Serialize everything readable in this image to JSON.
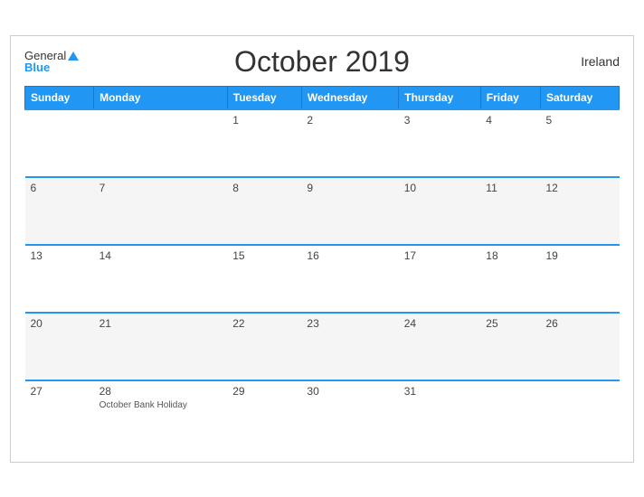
{
  "header": {
    "logo_general": "General",
    "logo_blue": "Blue",
    "title": "October 2019",
    "country": "Ireland"
  },
  "weekdays": [
    "Sunday",
    "Monday",
    "Tuesday",
    "Wednesday",
    "Thursday",
    "Friday",
    "Saturday"
  ],
  "weeks": [
    [
      {
        "day": "",
        "holiday": ""
      },
      {
        "day": "",
        "holiday": ""
      },
      {
        "day": "1",
        "holiday": ""
      },
      {
        "day": "2",
        "holiday": ""
      },
      {
        "day": "3",
        "holiday": ""
      },
      {
        "day": "4",
        "holiday": ""
      },
      {
        "day": "5",
        "holiday": ""
      }
    ],
    [
      {
        "day": "6",
        "holiday": ""
      },
      {
        "day": "7",
        "holiday": ""
      },
      {
        "day": "8",
        "holiday": ""
      },
      {
        "day": "9",
        "holiday": ""
      },
      {
        "day": "10",
        "holiday": ""
      },
      {
        "day": "11",
        "holiday": ""
      },
      {
        "day": "12",
        "holiday": ""
      }
    ],
    [
      {
        "day": "13",
        "holiday": ""
      },
      {
        "day": "14",
        "holiday": ""
      },
      {
        "day": "15",
        "holiday": ""
      },
      {
        "day": "16",
        "holiday": ""
      },
      {
        "day": "17",
        "holiday": ""
      },
      {
        "day": "18",
        "holiday": ""
      },
      {
        "day": "19",
        "holiday": ""
      }
    ],
    [
      {
        "day": "20",
        "holiday": ""
      },
      {
        "day": "21",
        "holiday": ""
      },
      {
        "day": "22",
        "holiday": ""
      },
      {
        "day": "23",
        "holiday": ""
      },
      {
        "day": "24",
        "holiday": ""
      },
      {
        "day": "25",
        "holiday": ""
      },
      {
        "day": "26",
        "holiday": ""
      }
    ],
    [
      {
        "day": "27",
        "holiday": ""
      },
      {
        "day": "28",
        "holiday": "October Bank Holiday"
      },
      {
        "day": "29",
        "holiday": ""
      },
      {
        "day": "30",
        "holiday": ""
      },
      {
        "day": "31",
        "holiday": ""
      },
      {
        "day": "",
        "holiday": ""
      },
      {
        "day": "",
        "holiday": ""
      }
    ]
  ]
}
